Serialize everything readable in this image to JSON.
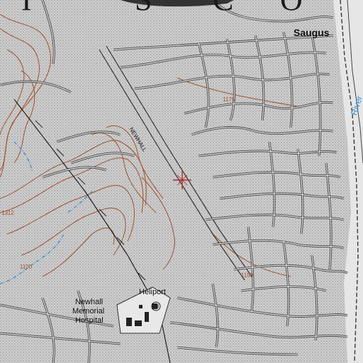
{
  "map": {
    "header_letters": [
      "I",
      "S",
      "C",
      "O"
    ],
    "place_labels": {
      "saugus": "Saugus",
      "heliport": "Heliport",
      "hospital_line1": "Newhall",
      "hospital_line2": "Memorial",
      "hospital_line3": "Hospital",
      "river": "River",
      "road": "NEWHALL"
    },
    "contour_labels": [
      "1175",
      "1150",
      "1100",
      "1312"
    ],
    "colors": {
      "paper": "#c9c9c9",
      "streets": "#3d3d3d",
      "street_fill": "#e4e4e4",
      "contours": "#a0522d",
      "water": "#3a8fd0",
      "target_marker": "#b03030"
    },
    "marker_icon": "crosshair-target-icon"
  }
}
